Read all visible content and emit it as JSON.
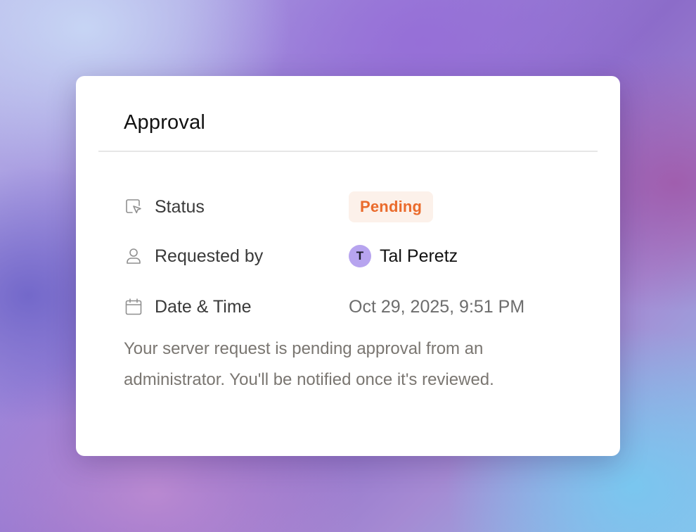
{
  "card": {
    "title": "Approval",
    "fields": {
      "status": {
        "label": "Status",
        "icon": "cursor-box-icon",
        "value": "Pending",
        "color": "#ea6b2c"
      },
      "requested_by": {
        "label": "Requested by",
        "icon": "user-icon",
        "avatar_initial": "T",
        "value": "Tal Peretz"
      },
      "date_time": {
        "label": "Date & Time",
        "icon": "calendar-icon",
        "value": "Oct 29, 2025, 9:51 PM"
      }
    },
    "description": "Your server request is pending approval from an administrator. You'll be notified once it's reviewed."
  }
}
